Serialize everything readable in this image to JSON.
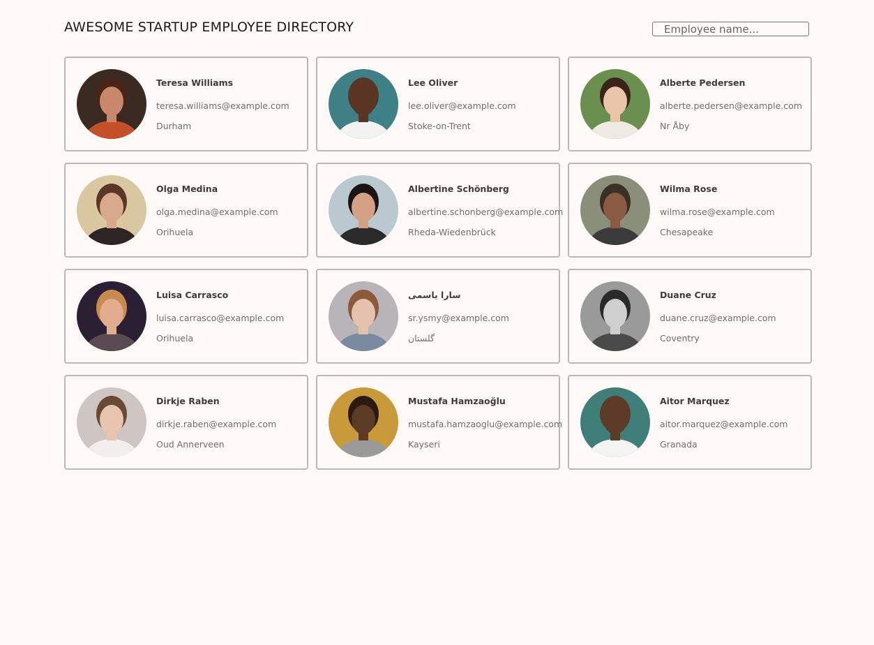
{
  "header": {
    "title": "AWESOME STARTUP EMPLOYEE DIRECTORY",
    "search_placeholder": "Employee name..."
  },
  "employees": [
    {
      "name": "Teresa Williams",
      "email": "teresa.williams@example.com",
      "city": "Durham",
      "avatar": {
        "bg": "#3a2a22",
        "skin": "#c9876b",
        "hair": "#4b2418",
        "shirt": "#c4502a"
      }
    },
    {
      "name": "Lee Oliver",
      "email": "lee.oliver@example.com",
      "city": "Stoke-on-Trent",
      "avatar": {
        "bg": "#3f7f86",
        "skin": "#5a3524",
        "hair": "#5a3524",
        "shirt": "#f2f2f2"
      }
    },
    {
      "name": "Alberte Pedersen",
      "email": "alberte.pedersen@example.com",
      "city": "Nr Åby",
      "avatar": {
        "bg": "#6b8f4e",
        "skin": "#e9c4a8",
        "hair": "#3a2418",
        "shirt": "#efe9e4"
      }
    },
    {
      "name": "Olga Medina",
      "email": "olga.medina@example.com",
      "city": "Orihuela",
      "avatar": {
        "bg": "#d9c7a0",
        "skin": "#d9a98c",
        "hair": "#5b3526",
        "shirt": "#2e2424"
      }
    },
    {
      "name": "Albertine Schönberg",
      "email": "albertine.schonberg@example.com",
      "city": "Rheda-Wiedenbrück",
      "avatar": {
        "bg": "#b9c9cf",
        "skin": "#d4a184",
        "hair": "#1b1414",
        "shirt": "#2a2a2a"
      }
    },
    {
      "name": "Wilma Rose",
      "email": "wilma.rose@example.com",
      "city": "Chesapeake",
      "avatar": {
        "bg": "#8a8f7a",
        "skin": "#8a5a42",
        "hair": "#3b2f26",
        "shirt": "#3b3b3b"
      }
    },
    {
      "name": "Luisa Carrasco",
      "email": "luisa.carrasco@example.com",
      "city": "Orihuela",
      "avatar": {
        "bg": "#2b1f33",
        "skin": "#e2ad8e",
        "hair": "#c98a4e",
        "shirt": "#5a4a52"
      }
    },
    {
      "name": "سارا یاسمی",
      "email": "sr.ysmy@example.com",
      "city": "گلستان",
      "avatar": {
        "bg": "#b8b4ba",
        "skin": "#e4c2ac",
        "hair": "#8a5a3a",
        "shirt": "#7a8aa0"
      }
    },
    {
      "name": "Duane Cruz",
      "email": "duane.cruz@example.com",
      "city": "Coventry",
      "avatar": {
        "bg": "#9a9a9a",
        "skin": "#cfcfcf",
        "hair": "#2a2a2a",
        "shirt": "#4a4a4a"
      }
    },
    {
      "name": "Dirkje Raben",
      "email": "dirkje.raben@example.com",
      "city": "Oud Annerveen",
      "avatar": {
        "bg": "#cdc6c2",
        "skin": "#e8c3ad",
        "hair": "#6b4a34",
        "shirt": "#f2eeee"
      }
    },
    {
      "name": "Mustafa Hamzaoğlu",
      "email": "mustafa.hamzaoglu@example.com",
      "city": "Kayseri",
      "avatar": {
        "bg": "#c99a3a",
        "skin": "#5b3a26",
        "hair": "#2a1a12",
        "shirt": "#9a9a9a"
      }
    },
    {
      "name": "Aitor Marquez",
      "email": "aitor.marquez@example.com",
      "city": "Granada",
      "avatar": {
        "bg": "#3f7f7a",
        "skin": "#5e3a28",
        "hair": "#5e3a28",
        "shirt": "#f4f4f4"
      }
    }
  ]
}
